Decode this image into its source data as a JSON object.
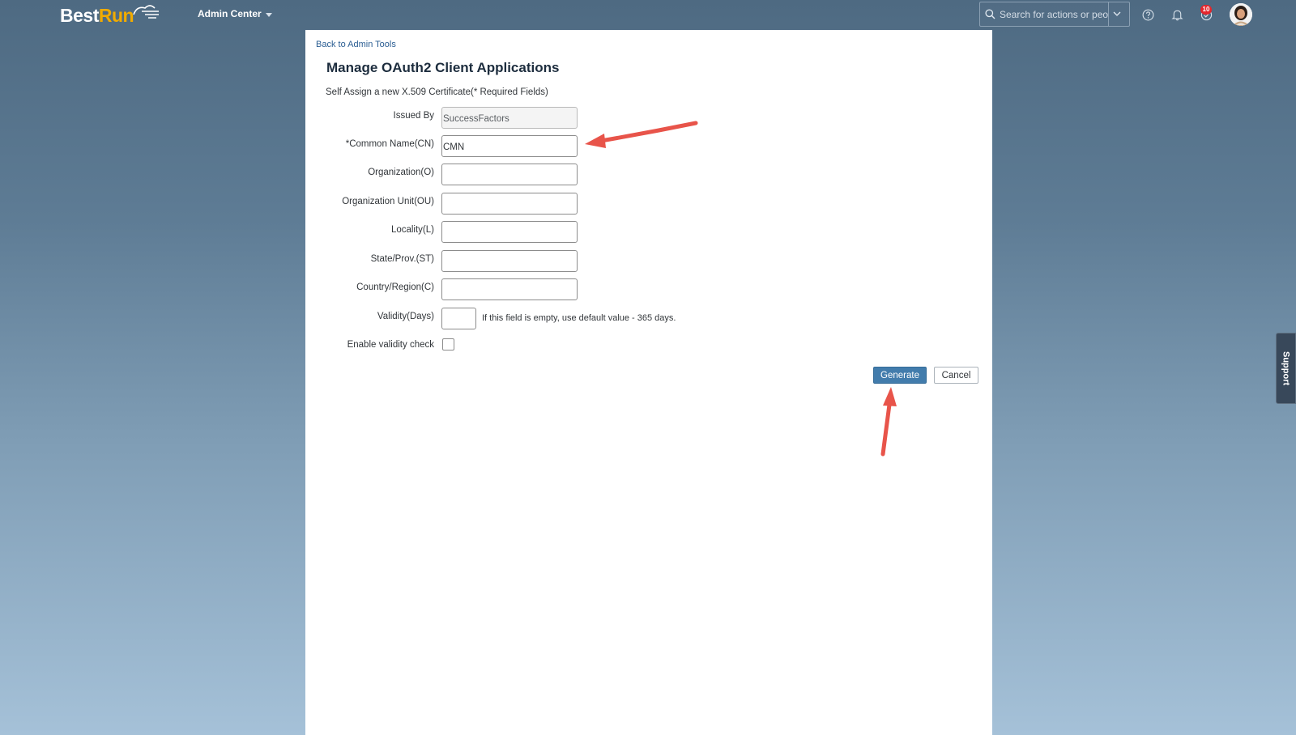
{
  "header": {
    "logo_best": "Best",
    "logo_run": "Run",
    "module": "Admin Center",
    "search_placeholder": "Search for actions or peo...",
    "notification_count": "10",
    "icons": [
      "search-icon",
      "chevron-down-icon",
      "help-icon",
      "bell-icon",
      "approvals-icon"
    ]
  },
  "page": {
    "back_link": "Back to Admin Tools",
    "title": "Manage OAuth2 Client Applications",
    "subtitle": "Self Assign a new X.509 Certificate(* Required Fields)"
  },
  "form": {
    "issued_by": {
      "label": "Issued By",
      "value": "SuccessFactors"
    },
    "common_name": {
      "label": "*Common Name(CN)",
      "value": "CMN"
    },
    "organization": {
      "label": "Organization(O)",
      "value": ""
    },
    "org_unit": {
      "label": "Organization Unit(OU)",
      "value": ""
    },
    "locality": {
      "label": "Locality(L)",
      "value": ""
    },
    "state": {
      "label": "State/Prov.(ST)",
      "value": ""
    },
    "country": {
      "label": "Country/Region(C)",
      "value": ""
    },
    "validity": {
      "label": "Validity(Days)",
      "value": "",
      "hint": "If this field is empty, use default value - 365 days."
    },
    "validity_check": {
      "label": "Enable validity check",
      "checked": false
    }
  },
  "buttons": {
    "generate": "Generate",
    "cancel": "Cancel"
  },
  "support": {
    "label": "Support"
  },
  "colors": {
    "primary_button": "#427cac",
    "annotation_arrow": "#e8544a",
    "logo_accent": "#f0ab00",
    "badge": "#e5262c"
  }
}
